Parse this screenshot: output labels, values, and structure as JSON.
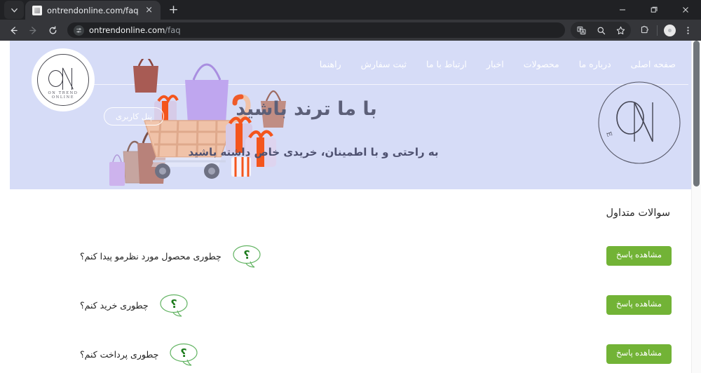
{
  "browser": {
    "tab": {
      "title": "ontrendonline.com/faq",
      "favicon": "page-icon"
    },
    "new_tab_label": "+",
    "close_label": "×",
    "toolbar": {
      "back": "back-arrow",
      "forward": "forward-arrow",
      "reload": "reload-arrow",
      "url_host": "ontrendonline.com",
      "url_path": "/faq",
      "site_settings": "tune-icon",
      "translate": "translate-icon",
      "zoom_search": "search-icon",
      "bookmark": "star-icon",
      "extensions": "puzzle-icon",
      "profile": "avatar-icon",
      "menu": "three-dots-icon"
    },
    "window": {
      "minimize": "minimize-icon",
      "maximize": "maximize-icon",
      "close": "close-icon"
    }
  },
  "page": {
    "hero": {
      "brand": {
        "initials": "ON",
        "subtitle": "ON TREND ONLINE"
      },
      "panel_button": "پنل کاربری",
      "title": "با ما ترند باشید",
      "subtitle": "به راحتی و با اطمینان، خریدی خاص داشته باشید",
      "nav": [
        {
          "label": "صفحه اصلی"
        },
        {
          "label": "درباره ما"
        },
        {
          "label": "محصولات"
        },
        {
          "label": "اخبار"
        },
        {
          "label": "ارتباط با ما"
        },
        {
          "label": "ثبت سفارش"
        },
        {
          "label": "راهنما"
        }
      ],
      "colors": {
        "background": "#d6dcf7",
        "title_text": "#5c5f78",
        "nav_text": "#ffffff"
      }
    },
    "faq": {
      "heading": "سوالات متداول",
      "button_color": "#72b336",
      "icon_color": "#4caf50",
      "items": [
        {
          "question": "چطوری محصول مورد نظرمو پیدا کنم؟",
          "button": "مشاهده پاسخ",
          "icon": "question-bubble-icon"
        },
        {
          "question": "چطوری خرید کنم؟",
          "button": "مشاهده پاسخ",
          "icon": "question-bubble-icon"
        },
        {
          "question": "چطوری پرداخت کنم؟",
          "button": "مشاهده پاسخ",
          "icon": "question-bubble-icon"
        }
      ]
    }
  }
}
